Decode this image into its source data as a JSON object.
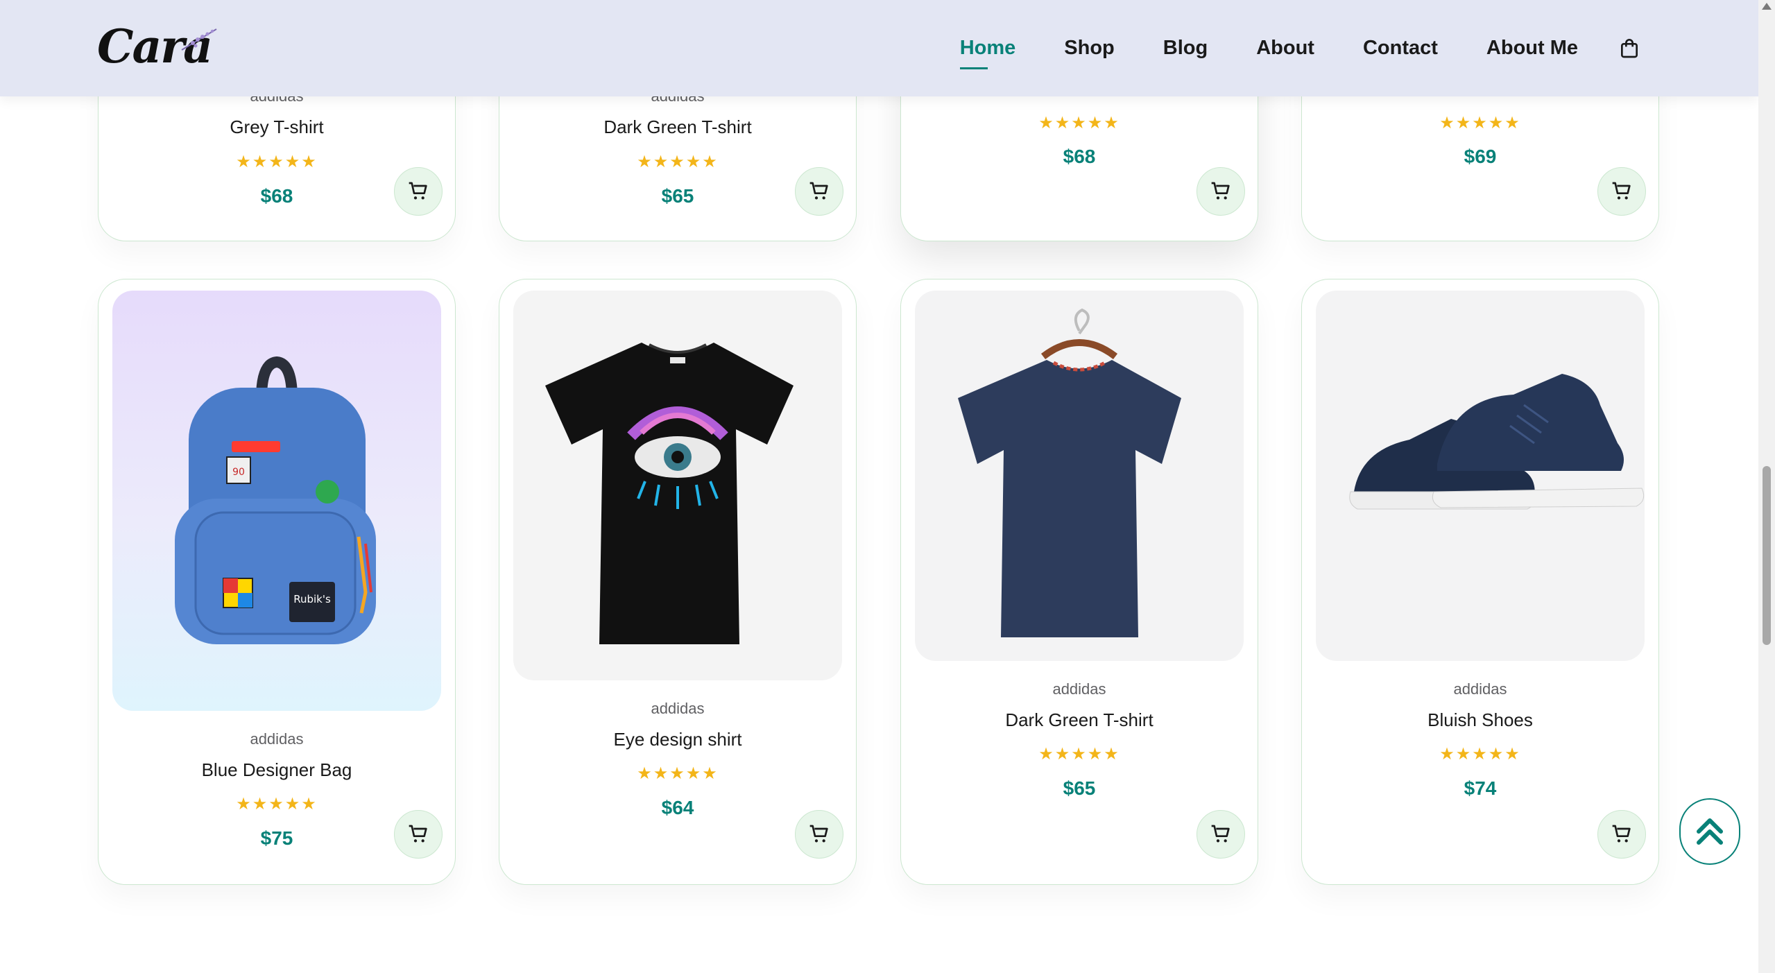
{
  "brand": {
    "logo_text": "Cara"
  },
  "nav": {
    "items": [
      "Home",
      "Shop",
      "Blog",
      "About",
      "Contact",
      "About Me"
    ],
    "active": "Home",
    "cart_icon": "shopping-bag-icon"
  },
  "products_top": [
    {
      "brand": "addidas",
      "name": "Grey T-shirt",
      "rating": 5,
      "stars": "★★★★★",
      "price": "$68"
    },
    {
      "brand": "addidas",
      "name": "Dark Green T-shirt",
      "rating": 5,
      "stars": "★★★★★",
      "price": "$65"
    },
    {
      "rating": 5,
      "stars": "★★★★★",
      "price": "$68"
    },
    {
      "rating": 5,
      "stars": "★★★★★",
      "price": "$69"
    }
  ],
  "products": [
    {
      "brand": "addidas",
      "name": "Blue Designer Bag",
      "rating": 5,
      "stars": "★★★★★",
      "price": "$75",
      "image": "backpack-image"
    },
    {
      "brand": "addidas",
      "name": "Eye design shirt",
      "rating": 5,
      "stars": "★★★★★",
      "price": "$64",
      "image": "tshirt-image"
    },
    {
      "brand": "addidas",
      "name": "Dark Green T-shirt",
      "rating": 5,
      "stars": "★★★★★",
      "price": "$65",
      "image": "tshirt-on-hanger-image"
    },
    {
      "brand": "addidas",
      "name": "Bluish Shoes",
      "rating": 5,
      "stars": "★★★★★",
      "price": "$74",
      "image": "sneakers-image"
    }
  ],
  "icons": {
    "add_to_cart": "cart-icon",
    "scroll_top": "double-chevron-up-icon"
  },
  "colors": {
    "accent": "#088178",
    "header_bg": "#e3e6f3",
    "star": "#f3b519",
    "cart_bg": "#e8f6ea"
  }
}
